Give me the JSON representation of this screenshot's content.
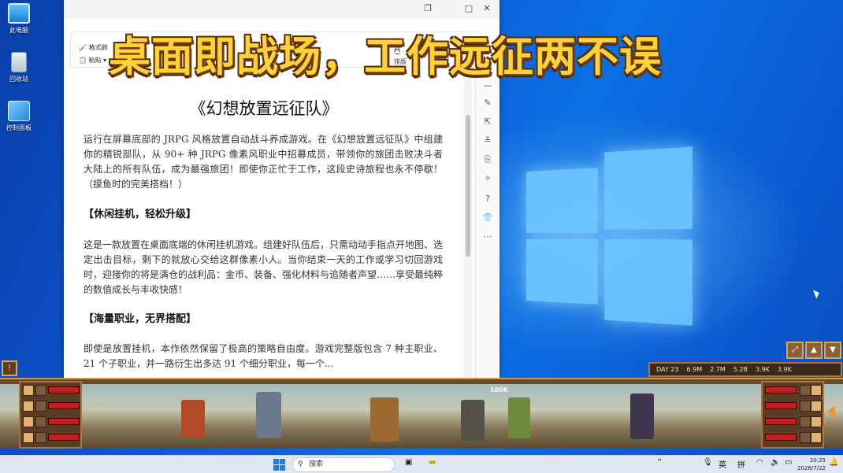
{
  "desktop": {
    "icons": [
      {
        "label": "此电脑"
      },
      {
        "label": "回收站"
      },
      {
        "label": "控制面板"
      }
    ]
  },
  "overlay": {
    "title": "桌面即战场，工作远征两不误"
  },
  "doc": {
    "ribbon": {
      "format_painter": "格式刷",
      "paste": "粘贴",
      "style_label": "排版"
    },
    "title": "《幻想放置远征队》",
    "intro": "运行在屏幕底部的 JRPG 风格放置自动战斗养成游戏。在《幻想放置远征队》中组建你的精锐部队，从 90+ 种 JRPG 像素风职业中招募成员，带领你的旅团击败决斗者大陆上的所有队伍，成为最强旅团！即使你正忙于工作，这段史诗旅程也永不停歇！ （摸鱼时的完美搭档！）",
    "h1": "【休闲挂机，轻松升级】",
    "p1": "这是一款放置在桌面底端的休闲挂机游戏。组建好队伍后，只需动动手指点开地图、选定出击目标，剩下的就放心交给这群像素小人。当你结束一天的工作或学习切回游戏时，迎接你的将是满仓的战利品：金币、装备、强化材料与追随者声望……享受最纯粹的数值成长与丰收快感！",
    "h2": "【海量职业，无界搭配】",
    "p2": "即使是放置挂机，本作依然保留了极高的策略自由度。游戏完整版包含 7 种主职业、21 个子职业，并一路衍生出多达 91 个细分职业，每一个..."
  },
  "game": {
    "stats": {
      "day": "DAY 23",
      "gold": "6.9M",
      "res1": "2.7M",
      "res2": "5.2B",
      "res3": "3.9K",
      "res4": "3.9K"
    },
    "combat_text": "100K"
  },
  "taskbar": {
    "search_placeholder": "搜索",
    "ime_lang": "英",
    "ime_mode": "拼",
    "time": "20:25",
    "date": "2026/7/22"
  },
  "colors": {
    "accent_title": "#ffd23a",
    "desktop_blue": "#0e58d6",
    "hp_red": "#c41e1e"
  }
}
